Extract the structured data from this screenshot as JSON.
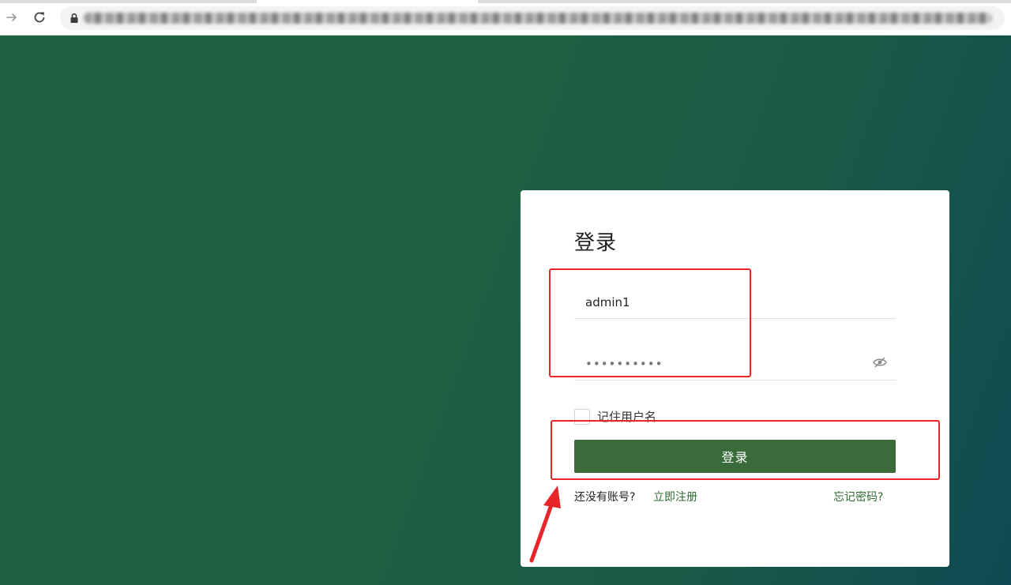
{
  "browser": {
    "forward_icon": "arrow-right-icon",
    "reload_icon": "reload-icon",
    "lock_icon": "lock-icon"
  },
  "login": {
    "title": "登录",
    "username_value": "admin1",
    "password_masked": "••••••••••",
    "eye_icon": "eye-slash-icon",
    "remember_label": "记住用户名",
    "remember_checked": false,
    "submit_label": "登录",
    "no_account_text": "还没有账号?",
    "register_link": "立即注册",
    "forgot_link": "忘记密码?"
  },
  "colors": {
    "background": "#1d6042",
    "button": "#3a6b3a",
    "link": "#2e6b2e",
    "annotation": "#e8262a"
  }
}
